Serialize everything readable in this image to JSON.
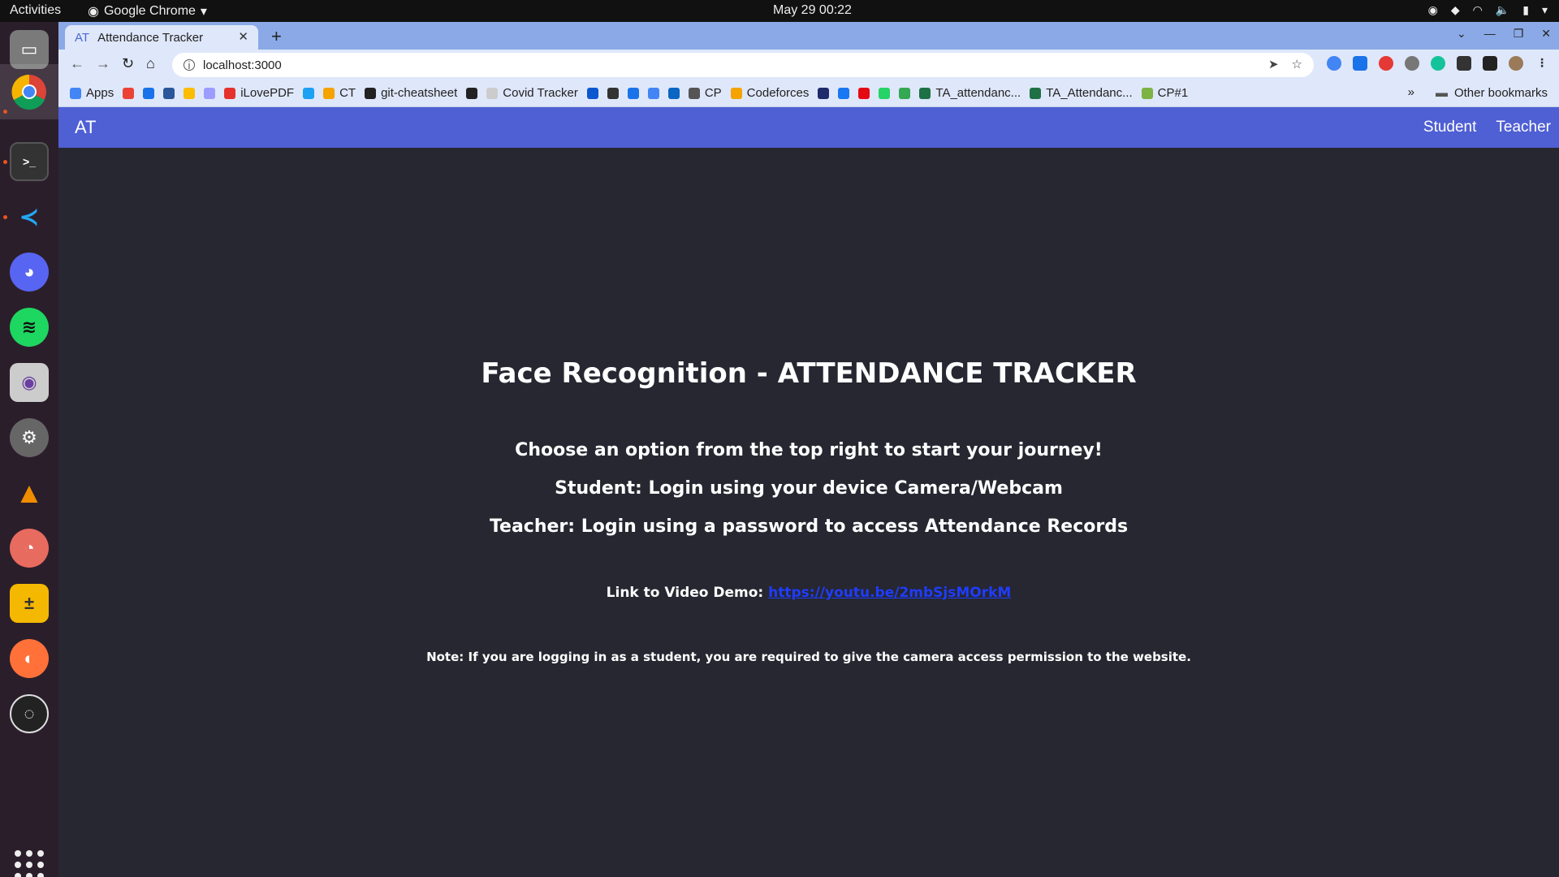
{
  "os": {
    "activities": "Activities",
    "app_menu": "Google Chrome",
    "clock": "May 29  00:22"
  },
  "browser": {
    "tab_title": "Attendance Tracker",
    "tab_icon": "AT",
    "url": "localhost:3000",
    "bookmarks": [
      {
        "label": "Apps",
        "color": "#4285f4"
      },
      {
        "label": "",
        "color": "#ea4335"
      },
      {
        "label": "",
        "color": "#1a73e8"
      },
      {
        "label": "",
        "color": "#2b579a"
      },
      {
        "label": "",
        "color": "#fbbc04"
      },
      {
        "label": "",
        "color": "#9c9cff"
      },
      {
        "label": "iLovePDF",
        "color": "#e5322d"
      },
      {
        "label": "",
        "color": "#1da1f2"
      },
      {
        "label": "CT",
        "color": "#f4a300"
      },
      {
        "label": "git-cheatsheet",
        "color": "#222222"
      },
      {
        "label": "",
        "color": "#222222"
      },
      {
        "label": "Covid Tracker",
        "color": "#cccccc"
      },
      {
        "label": "",
        "color": "#0b57d0"
      },
      {
        "label": "",
        "color": "#333333"
      },
      {
        "label": "",
        "color": "#1a73e8"
      },
      {
        "label": "",
        "color": "#4285f4"
      },
      {
        "label": "",
        "color": "#0a66c2"
      },
      {
        "label": "CP",
        "color": "#555555"
      },
      {
        "label": "Codeforces",
        "color": "#f4a300"
      },
      {
        "label": "",
        "color": "#1d2a6b"
      },
      {
        "label": "",
        "color": "#1877f2"
      },
      {
        "label": "",
        "color": "#e50914"
      },
      {
        "label": "",
        "color": "#25d366"
      },
      {
        "label": "",
        "color": "#34a853"
      },
      {
        "label": "TA_attendanc...",
        "color": "#1e7145"
      },
      {
        "label": "TA_Attendanc...",
        "color": "#1e7145"
      },
      {
        "label": "CP#1",
        "color": "#7cb342"
      }
    ],
    "more_bookmarks": "»",
    "other_bookmarks": "Other bookmarks"
  },
  "page": {
    "brand": "AT",
    "nav": {
      "student": "Student",
      "teacher": "Teacher"
    },
    "title": "Face Recognition - ATTENDANCE TRACKER",
    "lines": [
      "Choose an option from the top right to start your journey!",
      "Student: Login using your device Camera/Webcam",
      "Teacher: Login using a password to access Attendance Records"
    ],
    "demo_label": "Link to Video Demo: ",
    "demo_link": "https://youtu.be/2mbSjsMOrkM",
    "note": "Note: If you are logging in as a student, you are required to give the camera access permission to the website."
  },
  "colors": {
    "navbar": "#4f5fd4",
    "background": "#262731",
    "link": "#1f3cff"
  }
}
